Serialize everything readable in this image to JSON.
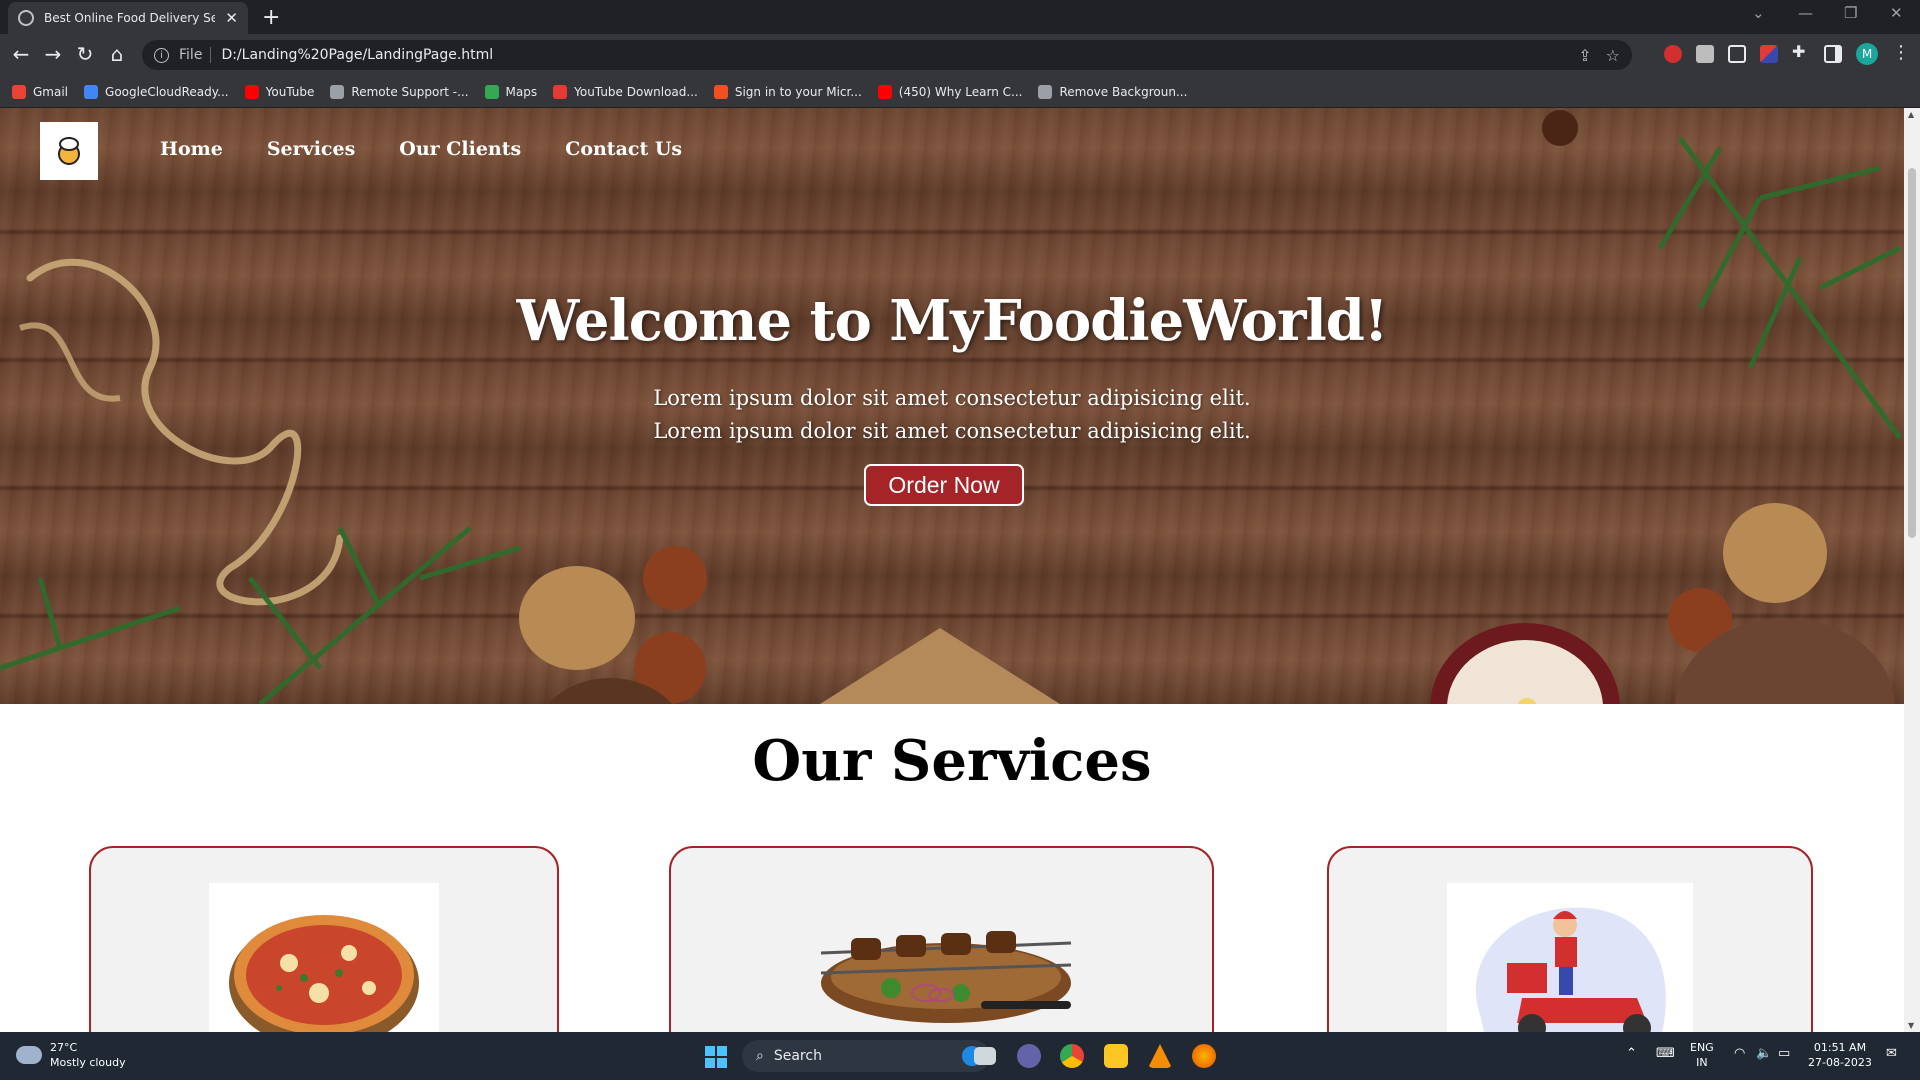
{
  "browser": {
    "tab_title": "Best Online Food Delivery Servic",
    "url_scheme": "File",
    "url": "D:/Landing%20Page/LandingPage.html",
    "avatar_letter": "M",
    "bookmarks": [
      {
        "label": "Gmail",
        "icon": "gmail-icon",
        "color": "#ea4335"
      },
      {
        "label": "GoogleCloudReady...",
        "icon": "google-icon",
        "color": "#4285f4"
      },
      {
        "label": "YouTube",
        "icon": "youtube-icon",
        "color": "#ff0000"
      },
      {
        "label": "Remote Support -...",
        "icon": "remote-support-icon",
        "color": "#9aa0a6"
      },
      {
        "label": "Maps",
        "icon": "maps-icon",
        "color": "#34a853"
      },
      {
        "label": "YouTube Download...",
        "icon": "download-icon",
        "color": "#e53935"
      },
      {
        "label": "Sign in to your Micr...",
        "icon": "microsoft-icon",
        "color": "#f25022"
      },
      {
        "label": "(450) Why Learn C...",
        "icon": "youtube-icon",
        "color": "#ff0000"
      },
      {
        "label": "Remove Backgroun...",
        "icon": "remove-bg-icon",
        "color": "#9aa0a6"
      }
    ]
  },
  "site": {
    "nav": [
      "Home",
      "Services",
      "Our Clients",
      "Contact Us"
    ],
    "hero_title": "Welcome to MyFoodieWorld!",
    "hero_line_1": "Lorem ipsum dolor sit amet consectetur adipisicing elit.",
    "hero_line_2": "Lorem ipsum dolor sit amet consectetur adipisicing elit.",
    "order_button": "Order Now",
    "services_title": "Our Services",
    "service_cards": [
      {
        "image": "pizza"
      },
      {
        "image": "kebab-skewers"
      },
      {
        "image": "delivery-scooter"
      }
    ]
  },
  "taskbar": {
    "temperature": "27°C",
    "weather": "Mostly cloudy",
    "search_placeholder": "Search",
    "lang_1": "ENG",
    "lang_2": "IN",
    "time": "01:51 AM",
    "date": "27-08-2023"
  },
  "colors": {
    "accent_red": "#a52428",
    "chrome_dark": "#202124",
    "chrome_toolbar": "#35363a"
  }
}
